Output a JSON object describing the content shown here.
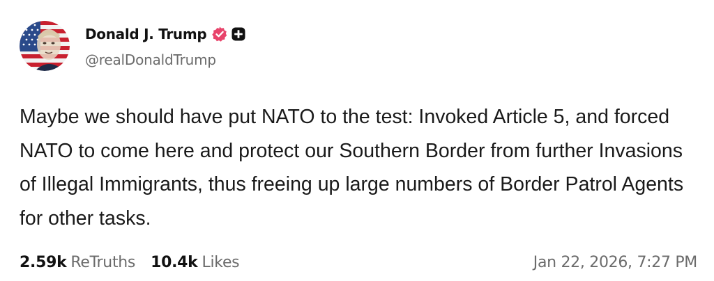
{
  "author": {
    "display_name": "Donald J. Trump",
    "handle": "@realDonaldTrump",
    "avatar_icon": "avatar-flag-portrait",
    "verified_icon": "verified-badge-icon",
    "plus_icon": "plus-badge-icon",
    "verified_color": "#e8446b"
  },
  "post": {
    "text": "Maybe we should have put NATO to the test: Invoked Article 5, and forced NATO to come here and protect our Southern Border from further Invasions of Illegal Immigrants, thus freeing up large numbers of Border Patrol Agents for other tasks."
  },
  "stats": {
    "retruths_count": "2.59k",
    "retruths_label": "ReTruths",
    "likes_count": "10.4k",
    "likes_label": "Likes"
  },
  "timestamp": "Jan 22, 2026, 7:27 PM"
}
